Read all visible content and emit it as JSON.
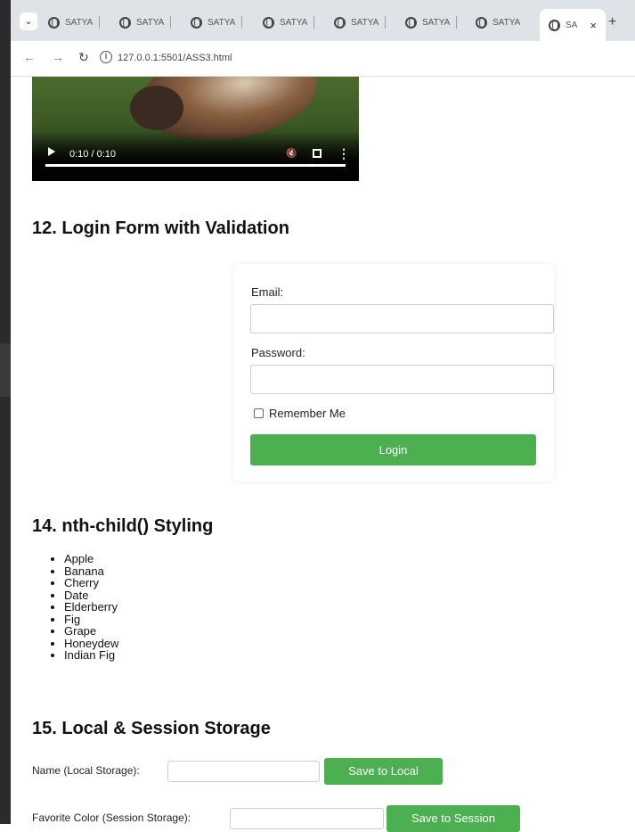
{
  "browser": {
    "tabs": [
      {
        "label": "SATYA"
      },
      {
        "label": "SATYA"
      },
      {
        "label": "SATYA"
      },
      {
        "label": "SATYA"
      },
      {
        "label": "SATYA"
      },
      {
        "label": "SATYA"
      },
      {
        "label": "SATYA"
      },
      {
        "label": "SA"
      }
    ],
    "close_glyph": "×",
    "new_tab_glyph": "+",
    "url": "127.0.0.1:5501/ASS3.html"
  },
  "video": {
    "time": "0:10 / 0:10",
    "progress": 1.0
  },
  "section12": {
    "title": "12. Login Form with Validation",
    "email_label": "Email:",
    "password_label": "Password:",
    "remember_label": "Remember Me",
    "login_button": "Login"
  },
  "section14": {
    "title": "14. nth-child() Styling",
    "items": [
      "Apple",
      "Banana",
      "Cherry",
      "Date",
      "Elderberry",
      "Fig",
      "Grape",
      "Honeydew",
      "Indian Fig"
    ]
  },
  "section15": {
    "title": "15. Local & Session Storage",
    "name_label": "Name (Local Storage):",
    "save_local": "Save to Local",
    "color_label": "Favorite Color (Session Storage):",
    "save_session": "Save to Session"
  },
  "colors": {
    "accent": "#4caf50"
  }
}
